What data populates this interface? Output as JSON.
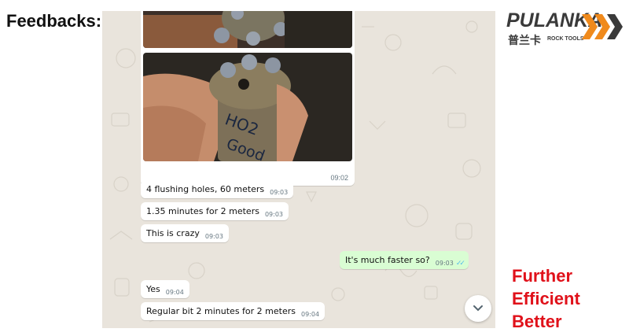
{
  "slide": {
    "title": "Feedbacks:"
  },
  "logo": {
    "brand": "PULANKA",
    "chinese": "普兰卡",
    "subtitle": "ROCK TOOLS",
    "accent": "#f08a1c"
  },
  "chat": {
    "image_message": {
      "time": "09:02",
      "photo_lettering": "HO2 Good"
    },
    "messages": [
      {
        "direction": "in",
        "text": "4 flushing holes, 60 meters",
        "time": "09:03"
      },
      {
        "direction": "in",
        "text": "1.35 minutes for 2 meters",
        "time": "09:03"
      },
      {
        "direction": "in",
        "text": "This is crazy",
        "time": "09:03"
      },
      {
        "direction": "out",
        "text": "It's much faster so?",
        "time": "09:03",
        "status": "read"
      },
      {
        "direction": "in",
        "text": "Yes",
        "time": "09:04"
      },
      {
        "direction": "in",
        "text": "Regular bit 2 minutes for 2 meters",
        "time": "09:04"
      }
    ],
    "scroll_icon": "chevron-down-icon"
  },
  "tagline": {
    "lines": [
      "Further",
      "Efficient",
      "Better"
    ],
    "color": "#e0111a"
  },
  "colors": {
    "chat_bg": "#e9e4dc",
    "outgoing_bubble": "#d9fdd3",
    "read_ticks": "#53bdeb"
  }
}
